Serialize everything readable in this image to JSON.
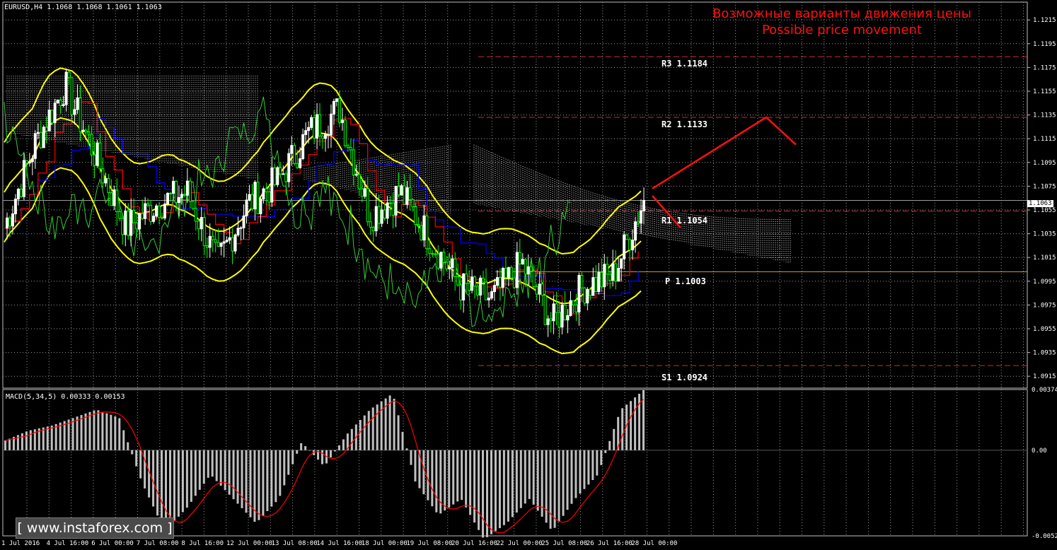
{
  "header": {
    "symbol_info": "EURUSD,H4  1.1068 1.1068 1.1061 1.1063"
  },
  "annotation": {
    "line_ru": "Возможные варианты движения цены",
    "line_en": "Possible price movement"
  },
  "levels": [
    {
      "label": "R3 1.1184",
      "value": 1.1184,
      "style": "dashed",
      "color": "#c83030"
    },
    {
      "label": "R2 1.1133",
      "value": 1.1133,
      "style": "dashed",
      "color": "#c83030"
    },
    {
      "label": "R1 1.1054",
      "value": 1.1054,
      "style": "dashed",
      "color": "#c83030"
    },
    {
      "label": "P 1.1003",
      "value": 1.1003,
      "style": "solid",
      "color": "#d4a017"
    },
    {
      "label": "S1 1.0924",
      "value": 1.0924,
      "style": "dashed",
      "color": "#c83030"
    }
  ],
  "current_price": "1.1063",
  "colors": {
    "bull": "#ffffff",
    "bear": "#00ff00",
    "bollinger": "#ffff00",
    "kijun": "#0000ff",
    "tenkan": "#ff0000",
    "chikou": "#32cd32",
    "forecast": "#ff1010",
    "macd_hist": "#c0c0c0",
    "macd_signal": "#ff0000"
  },
  "chart_data": [
    {
      "type": "line",
      "title": "EURUSD,H4",
      "ylim": [
        1.0905,
        1.123
      ],
      "y_ticks": [
        "1.1215",
        "1.1195",
        "1.1175",
        "1.1155",
        "1.1135",
        "1.1115",
        "1.1095",
        "1.1075",
        "1.1055",
        "1.1035",
        "1.1015",
        "1.0995",
        "1.0975",
        "1.0955",
        "1.0935",
        "1.0915"
      ],
      "x_tick_labels": [
        "1 Jul 2016",
        "4 Jul 16:00",
        "6 Jul 00:00",
        "7 Jul 08:00",
        "8 Jul 16:00",
        "12 Jul 00:00",
        "13 Jul 08:00",
        "14 Jul 16:00",
        "18 Jul 00:00",
        "19 Jul 08:00",
        "20 Jul 16:00",
        "22 Jul 00:00",
        "25 Jul 08:00",
        "26 Jul 16:00",
        "28 Jul 00:00"
      ],
      "close_approx": [
        1.104,
        1.111,
        1.116,
        1.11,
        1.104,
        1.106,
        1.107,
        1.101,
        1.106,
        1.108,
        1.112,
        1.114,
        1.105,
        1.107,
        1.103,
        1.099,
        1.098,
        1.101,
        1.096,
        1.099,
        1.1,
        1.1063
      ],
      "forecast_path": [
        1.1073,
        1.1133,
        1.111
      ],
      "forecast_alt": [
        1.1067,
        1.104
      ]
    },
    {
      "type": "bar",
      "title": "MACD(5,34,5) 0.00333 0.00153",
      "ylim": [
        -0.00528,
        0.00374
      ],
      "y_ticks": [
        "0.00374",
        "0.00",
        "-0.00528"
      ],
      "series": [
        {
          "values": [
            0.0006,
            0.0012,
            0.0015,
            0.002,
            0.0025,
            0.002,
            -0.002,
            -0.005,
            -0.0035,
            -0.0015,
            -0.003,
            -0.0045,
            -0.003,
            0.0005,
            -0.001,
            0.001,
            0.0025,
            0.0035,
            -0.002,
            -0.004,
            -0.003,
            -0.0055,
            -0.0045,
            -0.003,
            -0.005,
            -0.003,
            -0.0015,
            0.0025,
            0.0037
          ]
        }
      ]
    }
  ],
  "watermark": {
    "text": "[ www.instaforex.com ]"
  }
}
